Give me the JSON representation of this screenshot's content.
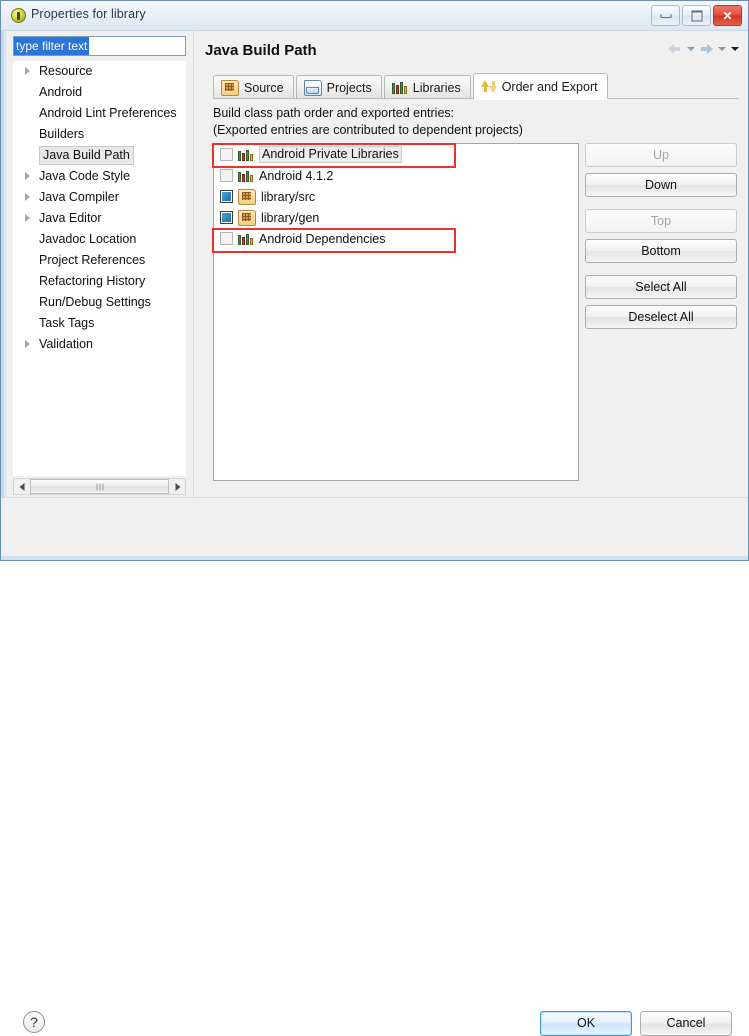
{
  "window": {
    "title": "Properties for library",
    "icon": "eclipse-properties-icon",
    "buttons": {
      "minimize": "minimize-icon",
      "maximize": "maximize-icon",
      "close": "close-icon"
    }
  },
  "sidebar": {
    "filter": {
      "value": "type filter text",
      "placeholder": "type filter text"
    },
    "items": [
      {
        "label": "Resource",
        "expandable": true,
        "selected": false
      },
      {
        "label": "Android",
        "expandable": false,
        "selected": false
      },
      {
        "label": "Android Lint Preferences",
        "expandable": false,
        "selected": false
      },
      {
        "label": "Builders",
        "expandable": false,
        "selected": false
      },
      {
        "label": "Java Build Path",
        "expandable": false,
        "selected": true
      },
      {
        "label": "Java Code Style",
        "expandable": true,
        "selected": false
      },
      {
        "label": "Java Compiler",
        "expandable": true,
        "selected": false
      },
      {
        "label": "Java Editor",
        "expandable": true,
        "selected": false
      },
      {
        "label": "Javadoc Location",
        "expandable": false,
        "selected": false
      },
      {
        "label": "Project References",
        "expandable": false,
        "selected": false
      },
      {
        "label": "Refactoring History",
        "expandable": false,
        "selected": false
      },
      {
        "label": "Run/Debug Settings",
        "expandable": false,
        "selected": false
      },
      {
        "label": "Task Tags",
        "expandable": false,
        "selected": false
      },
      {
        "label": "Validation",
        "expandable": true,
        "selected": false
      }
    ]
  },
  "main": {
    "page_title": "Java Build Path",
    "nav": {
      "back": "back-arrow-icon",
      "back_menu": "chevron-down-icon",
      "forward": "forward-arrow-icon",
      "forward_menu": "chevron-down-icon",
      "view_menu": "chevron-down-icon"
    },
    "tabs": [
      {
        "label": "Source",
        "icon": "source-folder-icon",
        "active": false
      },
      {
        "label": "Projects",
        "icon": "projects-folder-icon",
        "active": false
      },
      {
        "label": "Libraries",
        "icon": "libraries-books-icon",
        "active": false
      },
      {
        "label": "Order and Export",
        "icon": "order-export-arrows-icon",
        "active": true
      }
    ],
    "description_line1": "Build class path order and exported entries:",
    "description_line2": "(Exported entries are contributed to dependent projects)",
    "entries": [
      {
        "label": "Android Private Libraries",
        "checked": false,
        "icon": "libraries-books-icon",
        "selected": true,
        "highlighted": true
      },
      {
        "label": "Android 4.1.2",
        "checked": false,
        "icon": "libraries-books-icon",
        "selected": false,
        "highlighted": false
      },
      {
        "label": "library/src",
        "checked": true,
        "icon": "source-folder-icon",
        "selected": false,
        "highlighted": false
      },
      {
        "label": "library/gen",
        "checked": true,
        "icon": "source-folder-icon",
        "selected": false,
        "highlighted": false
      },
      {
        "label": "Android Dependencies",
        "checked": false,
        "icon": "libraries-books-icon",
        "selected": false,
        "highlighted": true
      }
    ],
    "side_buttons": [
      {
        "label": "Up",
        "enabled": false
      },
      {
        "label": "Down",
        "enabled": true
      },
      {
        "label": "Top",
        "enabled": false
      },
      {
        "label": "Bottom",
        "enabled": true
      },
      {
        "label": "Select All",
        "enabled": true
      },
      {
        "label": "Deselect All",
        "enabled": true
      }
    ]
  },
  "footer": {
    "help": "?",
    "ok": "OK",
    "cancel": "Cancel"
  },
  "annotation": {
    "color": "#e8322a",
    "boxes": [
      {
        "target": "Android Private Libraries"
      },
      {
        "target": "Android Dependencies"
      }
    ]
  }
}
